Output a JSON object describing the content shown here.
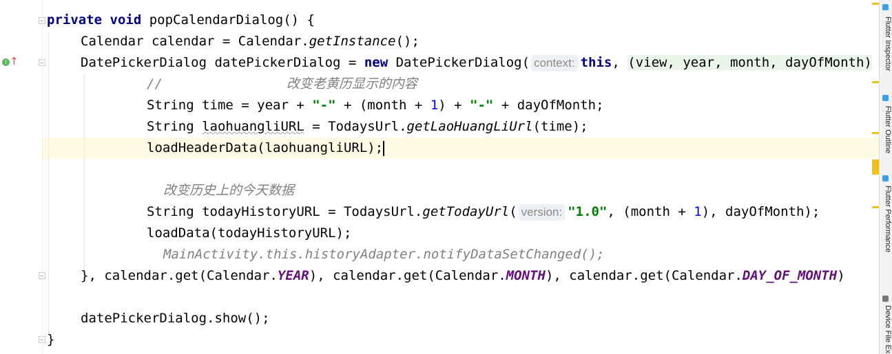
{
  "editor": {
    "lines": {
      "l1": {
        "kw1": "private",
        "kw2": "void",
        "rest": " popCalendarDialog() {"
      },
      "l2": {
        "a": "Calendar calendar = Calendar.",
        "b": "getInstance",
        "c": "();"
      },
      "l3": {
        "a": "DatePickerDialog datePickerDialog = ",
        "kw": "new",
        "b": " DatePickerDialog(",
        "hint": "context:",
        "kw2": "this",
        "c": ", ",
        "lambda": "(view, year, month, dayOfMonth)"
      },
      "l4": {
        "slashes": "//",
        "comment": "改变老黄历显示的内容"
      },
      "l5": {
        "a": "String time = year + ",
        "s1": "\"-\"",
        "b": " + (month + ",
        "n1": "1",
        "c": ") + ",
        "s2": "\"-\"",
        "d": " + dayOfMonth;"
      },
      "l6": {
        "a": "String ",
        "var": "laohuangliURL",
        "b": " = TodaysUrl.",
        "m": "getLaoHuangLiUrl",
        "c": "(time);"
      },
      "l7": {
        "a": "loadHeaderData(laohuangliURL);"
      },
      "l9": {
        "comment": "改变历史上的今天数据"
      },
      "l10": {
        "a": "String todayHistoryURL = TodaysUrl.",
        "m": "getTodayUrl",
        "b": "(",
        "hint": "version:",
        "s": "\"1.0\"",
        "c": ", (month + ",
        "n": "1",
        "d": "), dayOfMonth);"
      },
      "l11": {
        "a": "loadData(todayHistoryURL);"
      },
      "l12": {
        "a": "MainActivity.this.historyAdapter.notifyDataSetChanged();"
      },
      "l13": {
        "a": "}, calendar.get(Calendar.",
        "c1": "YEAR",
        "b": "), calendar.get(Calendar.",
        "c2": "MONTH",
        "c": "), calendar.get(Calendar.",
        "c3": "DAY_OF_MONTH",
        "d": ")"
      },
      "l15": {
        "a": "datePickerDialog.show();"
      },
      "l16": {
        "a": "}"
      }
    }
  },
  "gutter": {
    "impl_icon": "I",
    "impl_arrow": "↑"
  },
  "tool_windows": {
    "flutter_inspector": "Flutter Inspector",
    "flutter_outline": "Flutter Outline",
    "flutter_performance": "Flutter Performance",
    "device_file_explorer": "Device File Ex"
  },
  "colors": {
    "keyword": "#000080",
    "string": "#008000",
    "number": "#0000ff",
    "static_field": "#660e7a",
    "comment": "#808080",
    "caret_row": "#fffae3"
  }
}
